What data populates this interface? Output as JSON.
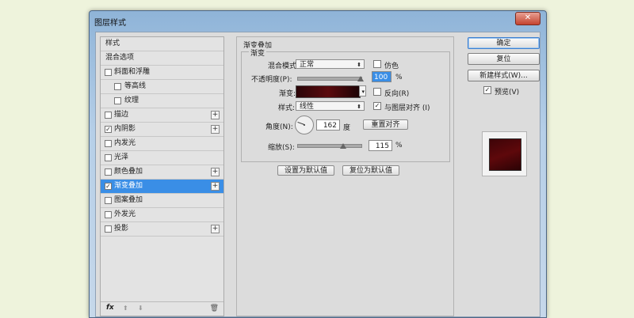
{
  "window": {
    "title": "图层样式",
    "close": "✕"
  },
  "stylelist": {
    "items": [
      {
        "label": "样式",
        "checkbox": false,
        "plus": false,
        "checked": false
      },
      {
        "label": "混合选项",
        "checkbox": false,
        "plus": false,
        "checked": false
      },
      {
        "label": "斜面和浮雕",
        "checkbox": true,
        "plus": false,
        "checked": false
      },
      {
        "label": "等高线",
        "checkbox": true,
        "plus": false,
        "checked": false,
        "sub": true
      },
      {
        "label": "纹理",
        "checkbox": true,
        "plus": false,
        "checked": false,
        "sub": true
      },
      {
        "label": "描边",
        "checkbox": true,
        "plus": true,
        "checked": false
      },
      {
        "label": "内阴影",
        "checkbox": true,
        "plus": true,
        "checked": true
      },
      {
        "label": "内发光",
        "checkbox": true,
        "plus": false,
        "checked": false
      },
      {
        "label": "光泽",
        "checkbox": true,
        "plus": false,
        "checked": false
      },
      {
        "label": "颜色叠加",
        "checkbox": true,
        "plus": true,
        "checked": false
      },
      {
        "label": "渐变叠加",
        "checkbox": true,
        "plus": true,
        "checked": true,
        "selected": true
      },
      {
        "label": "图案叠加",
        "checkbox": true,
        "plus": false,
        "checked": false
      },
      {
        "label": "外发光",
        "checkbox": true,
        "plus": false,
        "checked": false
      },
      {
        "label": "投影",
        "checkbox": true,
        "plus": true,
        "checked": false
      }
    ],
    "footer": {
      "fx": "fx",
      "up": "⬆",
      "down": "⬇",
      "trash": "🗑"
    }
  },
  "panel": {
    "group_title": "渐变叠加",
    "frame_title": "渐变",
    "blend_mode_label": "混合模式:",
    "blend_mode_value": "正常",
    "dither_label": "仿色",
    "opacity_label": "不透明度(P):",
    "opacity_value": "100",
    "percent": "%",
    "gradient_label": "渐变:",
    "reverse_label": "反向(R)",
    "style_label": "样式:",
    "style_value": "线性",
    "align_label": "与图层对齐 (I)",
    "angle_label": "角度(N):",
    "angle_value": "162",
    "degree": "度",
    "reset_align": "重置对齐",
    "scale_label": "缩放(S):",
    "scale_value": "115",
    "set_default": "设置为默认值",
    "reset_default": "复位为默认值",
    "opacity_level": 1.0,
    "scale_level": 0.72
  },
  "right": {
    "ok": "确定",
    "reset": "复位",
    "new_style": "新建样式(W)...",
    "preview_label": "预览(V)",
    "preview_checked": true
  },
  "colors": {
    "accent": "#3a8ee6",
    "gradient_dark": "#2a0508",
    "gradient_mid": "#5b0a0d"
  }
}
